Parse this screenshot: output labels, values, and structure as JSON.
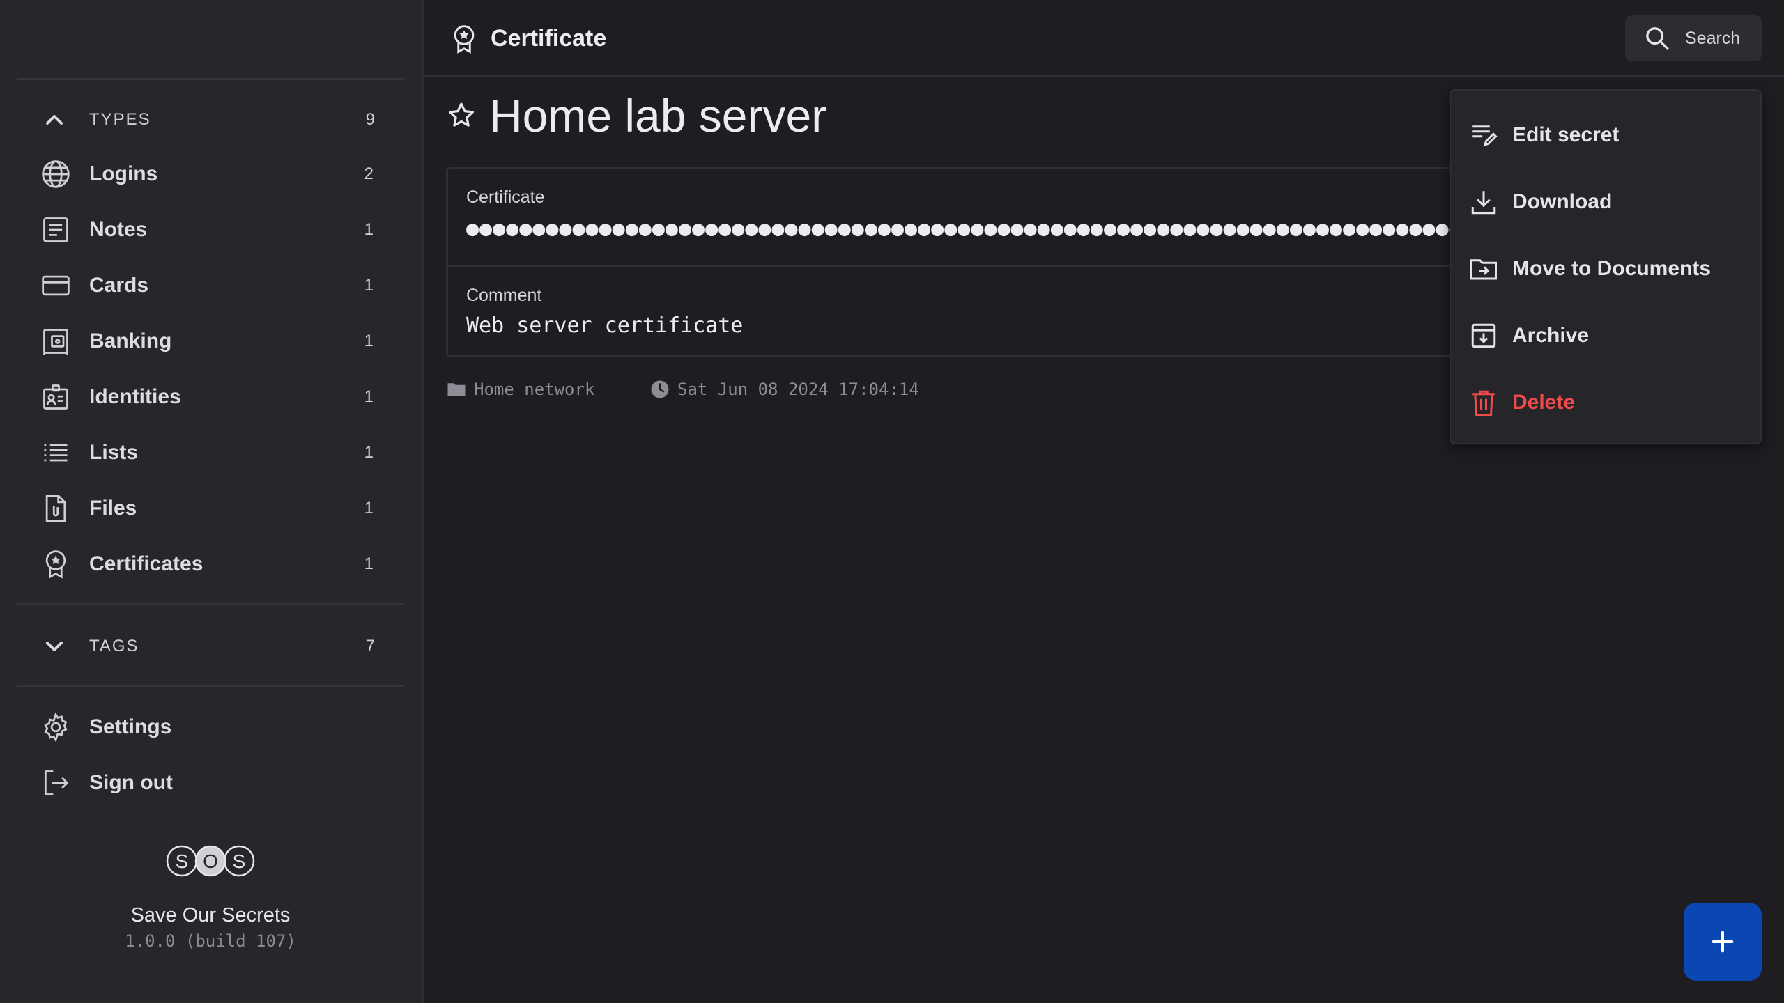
{
  "sidebar": {
    "types_header": {
      "label": "TYPES",
      "count": "9"
    },
    "items": [
      {
        "label": "Logins",
        "count": "2",
        "icon": "globe-icon"
      },
      {
        "label": "Notes",
        "count": "1",
        "icon": "note-icon"
      },
      {
        "label": "Cards",
        "count": "1",
        "icon": "credit-card-icon"
      },
      {
        "label": "Banking",
        "count": "1",
        "icon": "bank-icon"
      },
      {
        "label": "Identities",
        "count": "1",
        "icon": "identity-card-icon"
      },
      {
        "label": "Lists",
        "count": "1",
        "icon": "list-icon"
      },
      {
        "label": "Files",
        "count": "1",
        "icon": "file-icon"
      },
      {
        "label": "Certificates",
        "count": "1",
        "icon": "certificate-icon"
      }
    ],
    "tags_header": {
      "label": "TAGS",
      "count": "7"
    },
    "settings_label": "Settings",
    "signout_label": "Sign out",
    "brand": {
      "logo_letters": [
        "S",
        "O",
        "S"
      ],
      "name": "Save Our Secrets",
      "version": "1.0.0 (build 107)"
    }
  },
  "header": {
    "title": "Certificate",
    "search_label": "Search"
  },
  "secret": {
    "title": "Home lab server",
    "fields": [
      {
        "label": "Certificate",
        "value": "●●●●●●●●●●●●●●●●●●●●●●●●●●●●●●●●●●●●●●●●●●●●●●●●●●●●●●●●●●●●●●●●●●●●●●●●●●●●●●●●●●●●●●●●●●●●●●●●●●"
      },
      {
        "label": "Comment",
        "value": "Web server certificate"
      }
    ],
    "folder": "Home network",
    "modified": "Sat Jun 08 2024 17:04:14"
  },
  "menu": {
    "items": [
      {
        "label": "Edit secret",
        "icon": "edit-icon"
      },
      {
        "label": "Download",
        "icon": "download-icon"
      },
      {
        "label": "Move to Documents",
        "icon": "move-folder-icon"
      },
      {
        "label": "Archive",
        "icon": "archive-icon"
      },
      {
        "label": "Delete",
        "icon": "trash-icon"
      }
    ]
  },
  "colors": {
    "background": "#1d1d22",
    "sidebar": "#26262b",
    "danger": "#ef4b4b",
    "accent": "#0b47b3"
  }
}
